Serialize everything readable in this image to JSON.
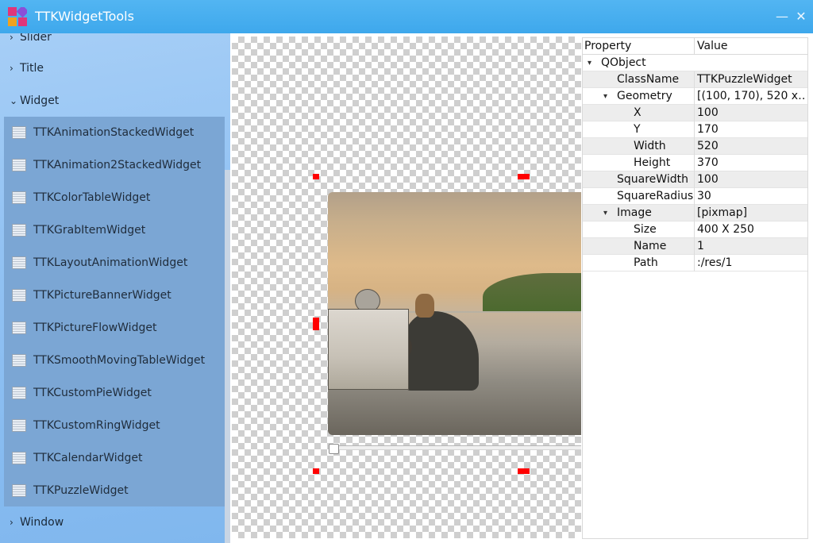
{
  "window": {
    "title": "TTKWidgetTools",
    "minimize_glyph": "—",
    "close_glyph": "✕"
  },
  "sidebar": {
    "categories": [
      {
        "label": "Slider",
        "chevron": "›"
      },
      {
        "label": "Title",
        "chevron": "›"
      },
      {
        "label": "Widget",
        "chevron": "⌄"
      },
      {
        "label": "Window",
        "chevron": "›"
      }
    ],
    "widgets": [
      {
        "label": "TTKAnimationStackedWidget"
      },
      {
        "label": "TTKAnimation2StackedWidget"
      },
      {
        "label": "TTKColorTableWidget"
      },
      {
        "label": "TTKGrabItemWidget"
      },
      {
        "label": "TTKLayoutAnimationWidget"
      },
      {
        "label": "TTKPictureBannerWidget"
      },
      {
        "label": "TTKPictureFlowWidget"
      },
      {
        "label": "TTKSmoothMovingTableWidget"
      },
      {
        "label": "TTKCustomPieWidget"
      },
      {
        "label": "TTKCustomRingWidget"
      },
      {
        "label": "TTKCalendarWidget"
      },
      {
        "label": "TTKPuzzleWidget"
      }
    ]
  },
  "properties": {
    "header": {
      "property": "Property",
      "value": "Value"
    },
    "rows": [
      {
        "name": "QObject",
        "value": "",
        "chevron": "▾"
      },
      {
        "name": "ClassName",
        "value": "TTKPuzzleWidget",
        "chevron": ""
      },
      {
        "name": "Geometry",
        "value": "[(100, 170), 520 x…",
        "chevron": "▾"
      },
      {
        "name": "X",
        "value": "100",
        "chevron": ""
      },
      {
        "name": "Y",
        "value": "170",
        "chevron": ""
      },
      {
        "name": "Width",
        "value": "520",
        "chevron": ""
      },
      {
        "name": "Height",
        "value": "370",
        "chevron": ""
      },
      {
        "name": "SquareWidth",
        "value": "100",
        "chevron": ""
      },
      {
        "name": "SquareRadius",
        "value": "30",
        "chevron": ""
      },
      {
        "name": "Image",
        "value": "[pixmap]",
        "chevron": "▾"
      },
      {
        "name": "Size",
        "value": "400 X 250",
        "chevron": ""
      },
      {
        "name": "Name",
        "value": "1",
        "chevron": ""
      },
      {
        "name": "Path",
        "value": ":/res/1",
        "chevron": ""
      }
    ]
  },
  "icons": {
    "logo": "ttk-logo-icon",
    "widget_item": "widget-item-icon",
    "minimize": "minimize-icon",
    "close": "close-icon"
  },
  "colors": {
    "titlebar": "#3ea8ec",
    "sidebar": "#92c2f3",
    "selected_list": "#7ba6d4",
    "handles": "#ff0000"
  }
}
